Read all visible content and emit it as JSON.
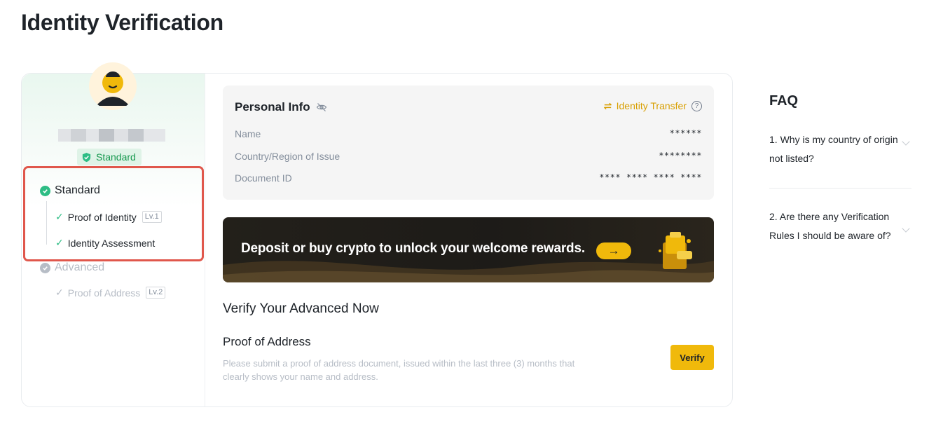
{
  "page": {
    "title": "Identity Verification"
  },
  "sidebar": {
    "level_badge": "Standard",
    "levels": [
      {
        "name": "Standard",
        "items": [
          {
            "label": "Proof of Identity",
            "tag": "Lv.1"
          },
          {
            "label": "Identity Assessment"
          }
        ]
      },
      {
        "name": "Advanced",
        "items": [
          {
            "label": "Proof of Address",
            "tag": "Lv.2"
          }
        ]
      }
    ]
  },
  "personal_info": {
    "title": "Personal Info",
    "transfer_label": "Identity Transfer",
    "help_glyph": "?",
    "rows": [
      {
        "label": "Name",
        "value": "******"
      },
      {
        "label": "Country/Region of Issue",
        "value": "********"
      },
      {
        "label": "Document ID",
        "value": "**** **** **** ****"
      }
    ]
  },
  "banner": {
    "text": "Deposit or buy crypto to unlock your welcome rewards.",
    "arrow": "→"
  },
  "verify": {
    "heading": "Verify Your Advanced Now",
    "item_title": "Proof of Address",
    "description": "Please submit a proof of address document, issued within the last three (3) months that clearly shows your name and address.",
    "button_label": "Verify"
  },
  "faq": {
    "title": "FAQ",
    "items": [
      {
        "question": "1. Why is my country of origin not listed?"
      },
      {
        "question": "2. Are there any Verification Rules I should be aware of?"
      }
    ]
  },
  "icons": {
    "level_check": "check-circle-icon",
    "eye_off": "eye-off-icon",
    "transfer": "swap-icon",
    "help": "help-circle-icon",
    "faq_toggle": "chevron-down-icon"
  },
  "colors": {
    "accent": "#f0b90b",
    "success": "#2ebd85",
    "highlight_border": "#e0574c",
    "link": "#d89f00"
  }
}
